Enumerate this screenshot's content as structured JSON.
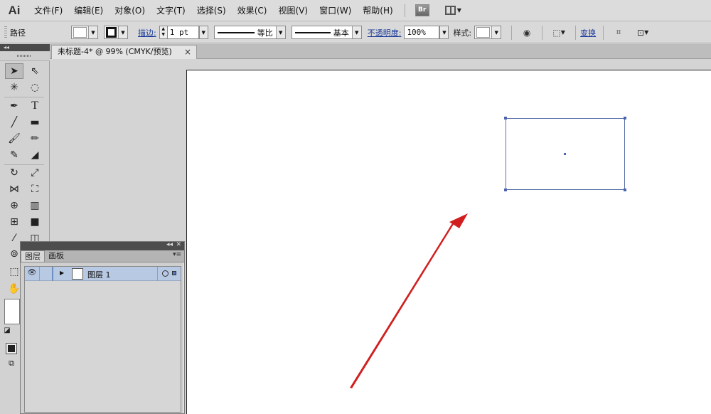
{
  "app": {
    "logo": "Ai"
  },
  "menu": {
    "items": [
      "文件(F)",
      "编辑(E)",
      "对象(O)",
      "文字(T)",
      "选择(S)",
      "效果(C)",
      "视图(V)",
      "窗口(W)",
      "帮助(H)"
    ],
    "bridge_label": "Br"
  },
  "control": {
    "selection_type": "路径",
    "stroke_label": "描边:",
    "stroke_weight": "1 pt",
    "variable_width": "等比",
    "brush": "基本",
    "opacity_label": "不透明度:",
    "opacity_value": "100%",
    "style_label": "样式:",
    "transform_label": "变换"
  },
  "document_tab": {
    "title": "未标题-4* @ 99% (CMYK/预览)",
    "close": "×"
  },
  "toolbox": {
    "collapse": "◂◂"
  },
  "layers_panel": {
    "tabs": [
      "图层",
      "画板"
    ],
    "collapse": "◂◂",
    "close": "✕",
    "menu": "▾≡",
    "layers": [
      {
        "name": "图层 1"
      }
    ]
  },
  "colors": {
    "selection_blue": "#4a64b0",
    "annotation_arrow": "#d11f1f",
    "layer_row_highlight": "#b7c9e3"
  },
  "icons": {
    "selection": "arrow-icon",
    "direct_selection": "hollow-arrow-icon",
    "pen": "pen-icon",
    "type": "type-icon",
    "line": "line-icon",
    "rectangle": "rectangle-icon",
    "paintbrush": "paintbrush-icon",
    "pencil": "pencil-icon",
    "eraser": "eraser-icon",
    "rotate": "rotate-icon",
    "scale": "scale-icon",
    "eyedropper": "eyedropper-icon",
    "hand": "hand-icon"
  }
}
